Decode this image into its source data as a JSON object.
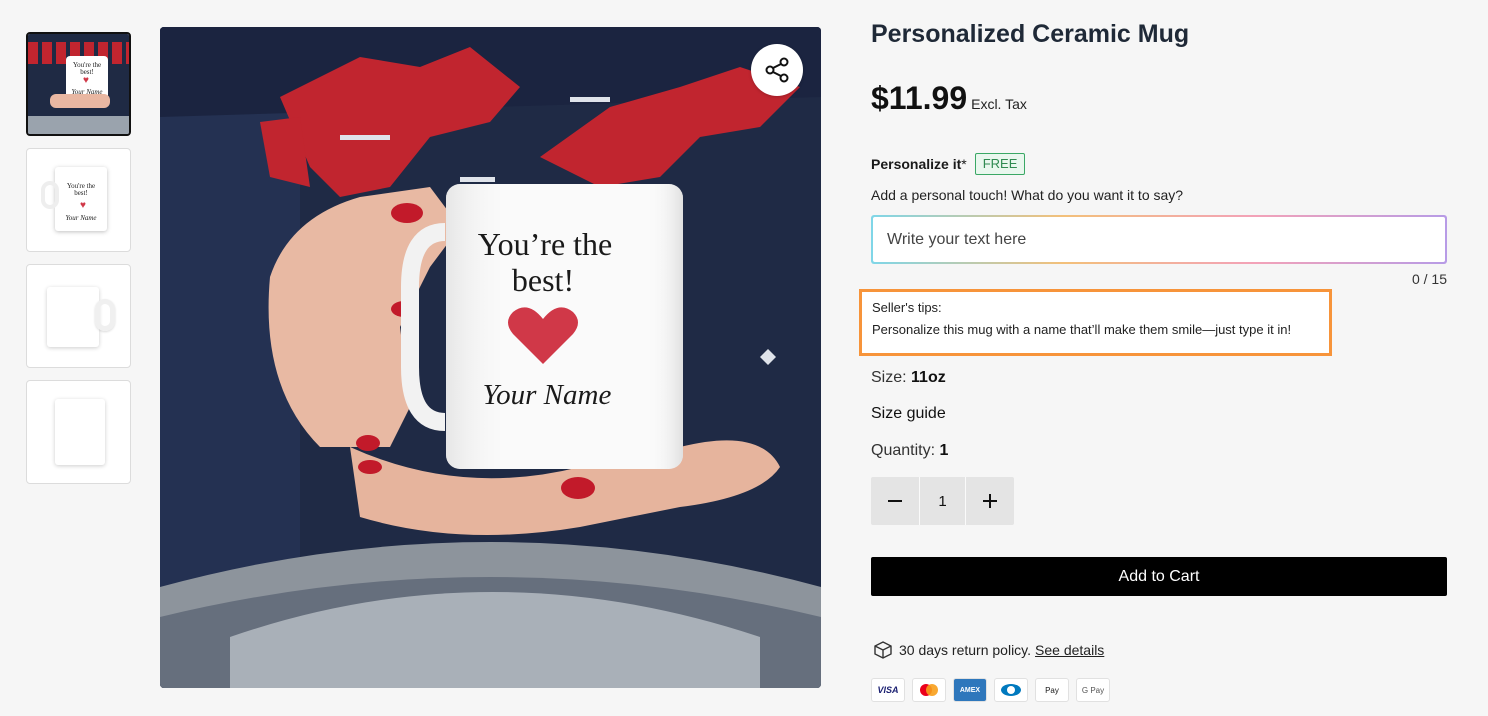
{
  "gallery": {
    "thumbnails": [
      {
        "mug_text": "You're the best!",
        "mug_name": "Your Name"
      },
      {
        "mug_text": "You're the best!",
        "mug_name": "Your Name"
      },
      {
        "mug_text": "",
        "mug_name": ""
      },
      {
        "mug_text": "",
        "mug_name": ""
      }
    ],
    "main_mug_text_1": "You’re the",
    "main_mug_text_2": "best!",
    "main_mug_name": "Your Name",
    "share_icon": "share-icon"
  },
  "product": {
    "title": "Personalized Ceramic Mug",
    "price": "$11.99",
    "tax_note": "Excl. Tax"
  },
  "personalize": {
    "label": "Personalize it",
    "required_mark": "*",
    "badge": "FREE",
    "help": "Add a personal touch! What do you want it to say?",
    "placeholder": "Write your text here",
    "value": "",
    "counter": "0 / 15"
  },
  "tips": {
    "title": "Seller's tips:",
    "body": "Personalize this mug with a name that’ll make them smile—just type it in!"
  },
  "options": {
    "size_label": "Size:",
    "size_value": "11oz",
    "size_guide": "Size guide",
    "quantity_label": "Quantity:",
    "quantity_value": "1",
    "stepper_value": "1"
  },
  "cart": {
    "add_label": "Add to Cart"
  },
  "policy": {
    "text": "30 days return policy.",
    "link": "See details"
  },
  "payments": [
    "VISA",
    "mastercard",
    "AMEX",
    "diners",
    "Apple Pay",
    "G Pay"
  ],
  "colors": {
    "accent_orange": "#f7943a",
    "free_green": "#2f8a50",
    "button_black": "#000000",
    "heart_red": "#d03848"
  }
}
